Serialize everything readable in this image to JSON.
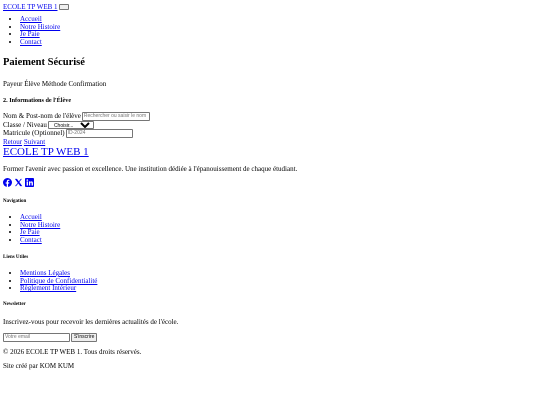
{
  "header": {
    "logo": "ECOLE TP WEB 1",
    "nav": [
      "Accueil",
      "Notre Histoire",
      "Je Paie",
      "Contact"
    ]
  },
  "page": {
    "title": "Paiement Sécurisé",
    "steps": "Payeur Élève Méthode Confirmation",
    "section_title": "2. Informations de l'Élève",
    "name_label": "Nom & Post-nom de l'élève",
    "name_placeholder": "Rechercher ou saisir le nom",
    "class_label": "Classe / Niveau",
    "class_selected": "Choisir...",
    "matricule_label": "Matricule (Optionnel)",
    "matricule_placeholder": "ID-2024",
    "back_link": "Retour",
    "next_link": "Suivant"
  },
  "footer": {
    "title": "ECOLE TP WEB 1",
    "tagline": "Former l'avenir avec passion et excellence. Une institution dédiée à l'épanouissement de chaque étudiant.",
    "social_icons": [
      "facebook-icon",
      "x-icon",
      "linkedin-icon"
    ],
    "nav_title": "Navigation",
    "nav": [
      "Accueil",
      "Notre Histoire",
      "Je Paie",
      "Contact"
    ],
    "links_title": "Liens Utiles",
    "links": [
      "Mentions Légales",
      "Politique de Confidentialité",
      "Règlement Intérieur"
    ],
    "newsletter_title": "Newsletter",
    "newsletter_text": "Inscrivez-vous pour recevoir les dernières actualités de l'école.",
    "email_placeholder": "Votre email",
    "subscribe_label": "S'inscrire",
    "copyright": "© 2026 ECOLE TP WEB 1. Tous droits réservés.",
    "credit": "Site créé par KOM KUM"
  }
}
